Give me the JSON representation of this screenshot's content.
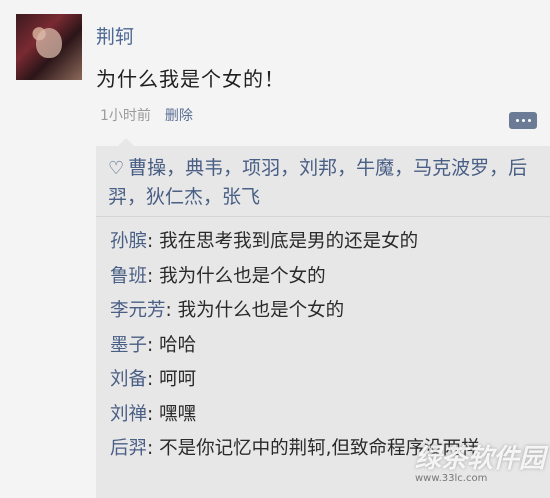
{
  "post": {
    "username": "荆轲",
    "text": "为什么我是个女的！",
    "time": "1小时前",
    "delete_label": "删除"
  },
  "likes": {
    "icon": "heart-icon",
    "names": "曹操，典韦，项羽，刘邦，牛魔，马克波罗，后羿，狄仁杰，张飞"
  },
  "comments": [
    {
      "name": "孙膑",
      "text": "我在思考我到底是男的还是女的"
    },
    {
      "name": "鲁班",
      "text": "我为什么也是个女的"
    },
    {
      "name": "李元芳",
      "text": "我为什么也是个女的"
    },
    {
      "name": "墨子",
      "text": "哈哈"
    },
    {
      "name": "刘备",
      "text": "呵呵"
    },
    {
      "name": "刘禅",
      "text": "嘿嘿"
    },
    {
      "name": "后羿",
      "text": "不是你记忆中的荆轲,但致命程序没两样"
    }
  ],
  "watermark": {
    "text": "绿茶软件园",
    "url": "www.33lc.com"
  }
}
